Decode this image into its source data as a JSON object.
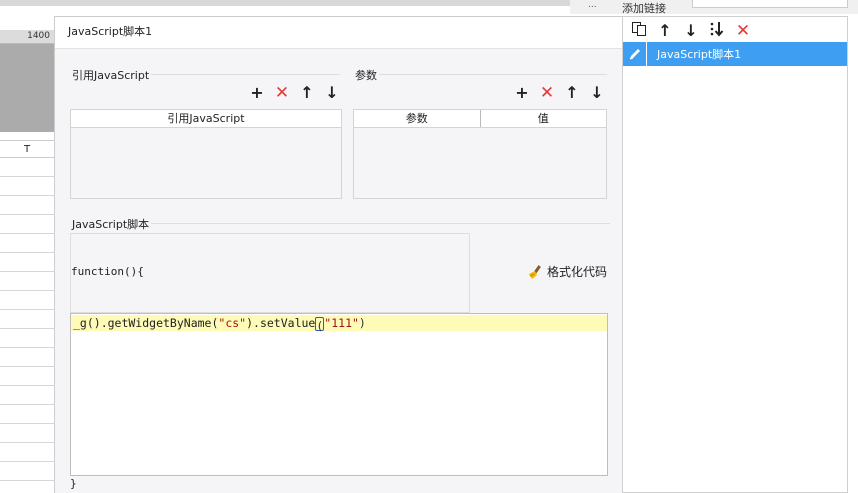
{
  "background": {
    "ruler_value": "1400",
    "column_header": "T"
  },
  "top": {
    "dots": "...",
    "tab_label": "添加链接"
  },
  "dialog": {
    "title": "JavaScript脚本1",
    "ref_section": {
      "label": "引用JavaScript",
      "toolbar": {
        "add": "+",
        "delete": "✕",
        "up": "↑",
        "down": "↓"
      },
      "columns": [
        "引用JavaScript"
      ]
    },
    "param_section": {
      "label": "参数",
      "toolbar": {
        "add": "+",
        "delete": "✕",
        "up": "↑",
        "down": "↓"
      },
      "columns": [
        "参数",
        "值"
      ]
    },
    "script_section": {
      "label": "JavaScript脚本",
      "function_header": "function(){",
      "format_button": "格式化代码",
      "code_prefix": "_g().getWidgetByName(",
      "code_str1": "\"cs\"",
      "code_mid": ").setValue",
      "code_paren_open": "(",
      "code_str2": "\"111\"",
      "code_paren_close": ")",
      "closing_brace": "}"
    }
  },
  "right_panel": {
    "toolbar": {
      "copy": "copy",
      "up": "↑",
      "down": "↓",
      "sort": "sort",
      "delete": "✕"
    },
    "items": [
      {
        "label": "JavaScript脚本1",
        "selected": true
      }
    ]
  },
  "colors": {
    "accent": "#3e9ff2",
    "delete_red": "#e53935",
    "code_highlight": "#fdfbb7",
    "string_color": "#a31515"
  }
}
